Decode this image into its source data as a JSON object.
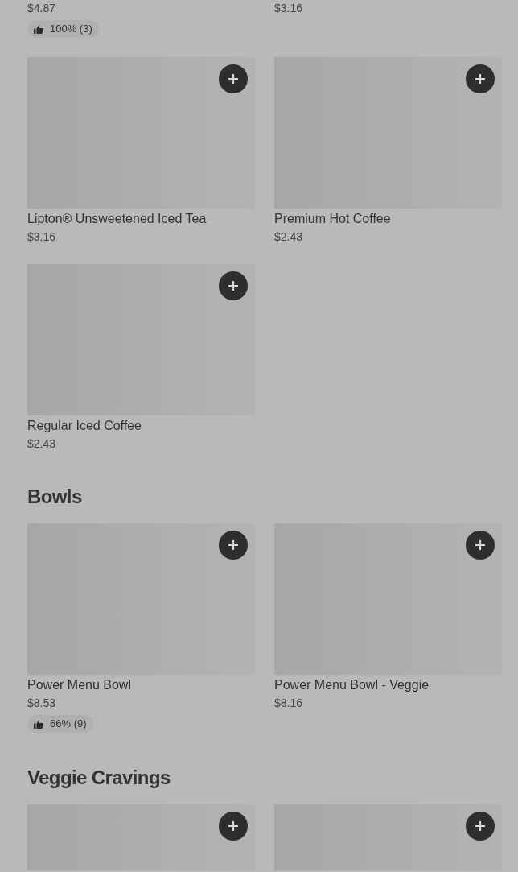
{
  "sections": [
    {
      "items": [
        {
          "kind": "tail",
          "price": "$4.87",
          "rating": "100% (3)"
        },
        {
          "kind": "tail",
          "price": "$3.16"
        },
        {
          "kind": "card",
          "name": "Lipton® Unsweetened Iced Tea",
          "price": "$3.16"
        },
        {
          "kind": "card",
          "name": "Premium Hot Coffee",
          "price": "$2.43"
        },
        {
          "kind": "card",
          "name": "Regular Iced Coffee",
          "price": "$2.43"
        }
      ]
    },
    {
      "title": "Bowls",
      "items": [
        {
          "kind": "card",
          "name": "Power Menu Bowl",
          "price": "$8.53",
          "rating": "66% (9)"
        },
        {
          "kind": "card",
          "name": "Power Menu Bowl - Veggie",
          "price": "$8.16"
        }
      ]
    },
    {
      "title": "Veggie Cravings",
      "items": [
        {
          "kind": "head"
        },
        {
          "kind": "head"
        }
      ]
    }
  ]
}
